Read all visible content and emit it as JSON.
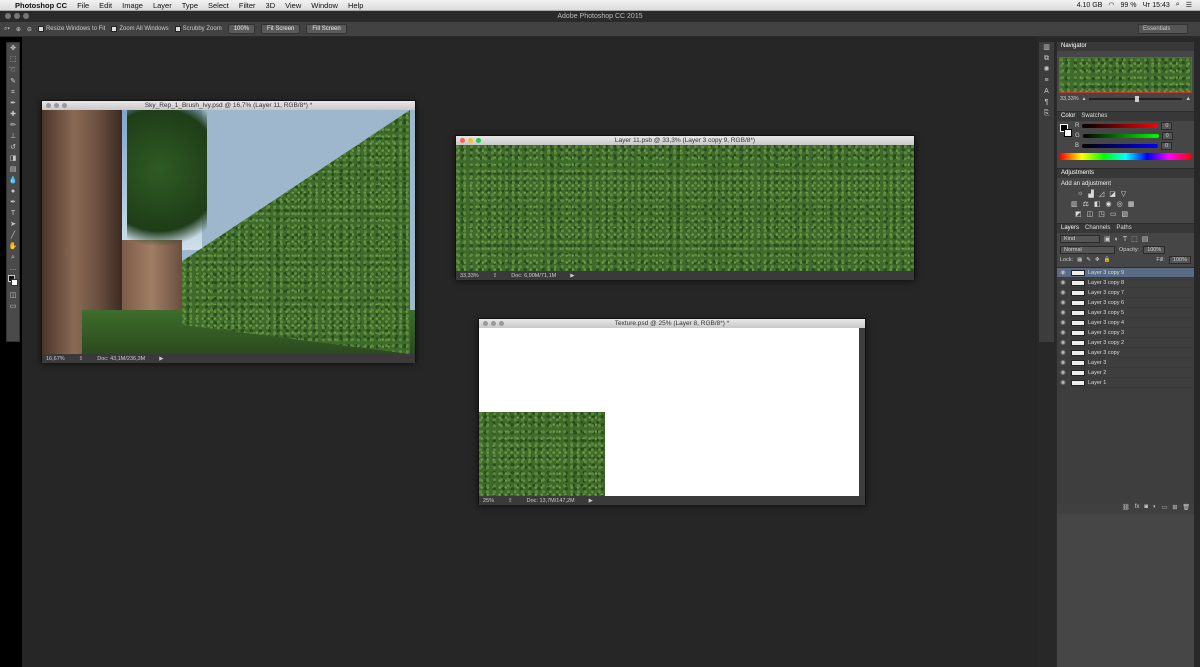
{
  "menubar": {
    "apple": "",
    "app": "Photoshop CC",
    "items": [
      "File",
      "Edit",
      "Image",
      "Layer",
      "Type",
      "Select",
      "Filter",
      "3D",
      "View",
      "Window",
      "Help"
    ],
    "memory": "4.10 GB",
    "battery": "99 %",
    "clock": "Чт 15:43"
  },
  "window": {
    "title": "Adobe Photoshop CC 2015"
  },
  "options": {
    "resize": "Resize Windows to Fit",
    "zoom_all": "Zoom All Windows",
    "scrubby": "Scrubby Zoom",
    "btn_100": "100%",
    "fit_screen": "Fit Screen",
    "fill_screen": "Fill Screen",
    "workspace": "Essentials"
  },
  "docs": [
    {
      "title": "Sky_Rep_1_Brush_Ivy.psd @ 16,7% (Layer 11, RGB/8*) *",
      "zoom": "16,67%",
      "info": "Doc: 43,1M/236,3M"
    },
    {
      "title": "Layer 11.psb @ 33,3% (Layer 3 copy 9, RGB/8*)",
      "zoom": "33,33%",
      "info": "Doc: 6,90M/71,1M"
    },
    {
      "title": "Texture.psd @ 25% (Layer 8, RGB/8*) *",
      "zoom": "25%",
      "info": "Doc: 13,7M/147,2M"
    }
  ],
  "navigator": {
    "tab": "Navigator",
    "zoom": "33,33%"
  },
  "color": {
    "tabs": [
      "Color",
      "Swatches"
    ],
    "r": "0",
    "g": "0",
    "b": "0"
  },
  "adjustments": {
    "tab": "Adjustments",
    "label": "Add an adjustment"
  },
  "layers": {
    "tabs": [
      "Layers",
      "Channels",
      "Paths"
    ],
    "kind": "Kind",
    "blend": "Normal",
    "opacity_label": "Opacity:",
    "opacity": "100%",
    "lock_label": "Lock:",
    "fill_label": "Fill:",
    "fill": "100%",
    "items": [
      "Layer 3 copy 9",
      "Layer 3 copy 8",
      "Layer 3 copy 7",
      "Layer 3 copy 6",
      "Layer 3 copy 5",
      "Layer 3 copy 4",
      "Layer 3 copy 3",
      "Layer 3 copy 2",
      "Layer 3 copy",
      "Layer 3",
      "Layer 2",
      "Layer 1"
    ],
    "selected_index": 0
  }
}
